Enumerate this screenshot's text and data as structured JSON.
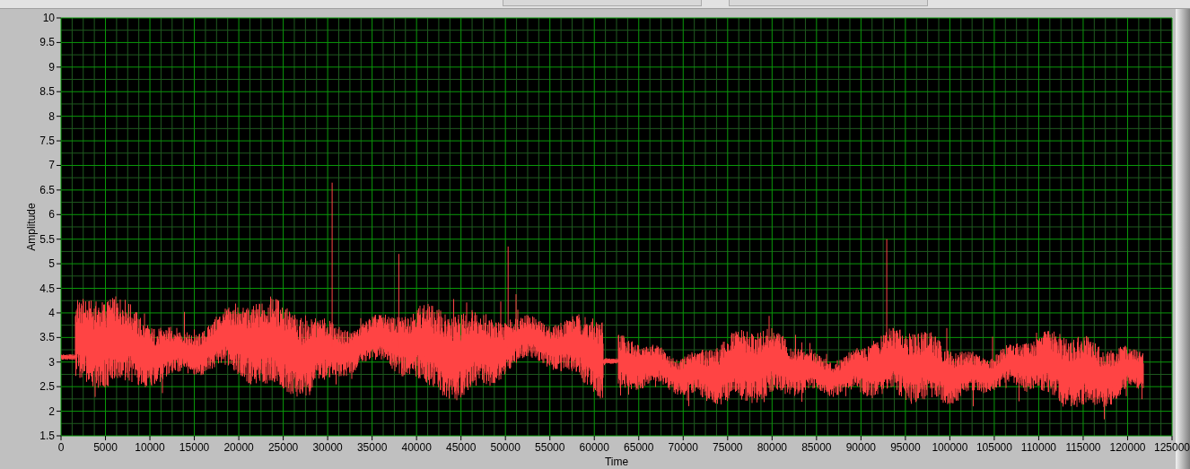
{
  "graph": {
    "y_axis": {
      "label": "Amplitude",
      "ticks": [
        "10",
        "9.5",
        "9",
        "8.5",
        "8",
        "7.5",
        "7",
        "6.5",
        "6",
        "5.5",
        "5",
        "4.5",
        "4",
        "3.5",
        "3",
        "2.5",
        "2",
        "1.5"
      ]
    },
    "x_axis": {
      "label": "Time",
      "ticks": [
        "0",
        "5000",
        "10000",
        "15000",
        "20000",
        "25000",
        "30000",
        "35000",
        "40000",
        "45000",
        "50000",
        "55000",
        "60000",
        "65000",
        "70000",
        "75000",
        "80000",
        "85000",
        "90000",
        "95000",
        "100000",
        "105000",
        "110000",
        "115000",
        "120000",
        "125000"
      ]
    }
  }
}
